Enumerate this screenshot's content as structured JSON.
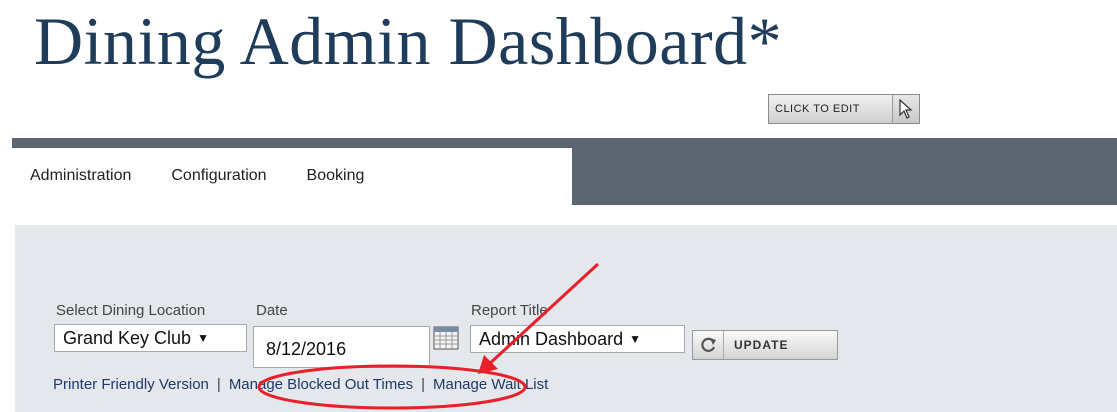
{
  "page": {
    "title": "Dining Admin Dashboard*"
  },
  "edit_button": {
    "label": "CLICK TO EDIT",
    "icon": "cursor-icon"
  },
  "nav": {
    "tabs": [
      {
        "label": "Administration"
      },
      {
        "label": "Configuration"
      },
      {
        "label": "Booking"
      }
    ]
  },
  "form": {
    "location": {
      "label": "Select Dining Location",
      "value": "Grand Key Club"
    },
    "date": {
      "label": "Date",
      "value": "8/12/2016",
      "icon": "calendar-icon"
    },
    "report": {
      "label": "Report Title",
      "value": "Admin Dashboard"
    },
    "update_button": {
      "label": "UPDATE",
      "icon": "refresh-icon"
    }
  },
  "links": {
    "printer": "Printer Friendly Version",
    "separator": "|",
    "blocked": "Manage Blocked Out Times",
    "waitlist": "Manage Wait List"
  },
  "colors": {
    "title": "#1f3d5a",
    "nav_bar": "#5c6670",
    "panel": "#e4e7ec",
    "link": "#1f3a66",
    "annotation": "#e8202a"
  }
}
